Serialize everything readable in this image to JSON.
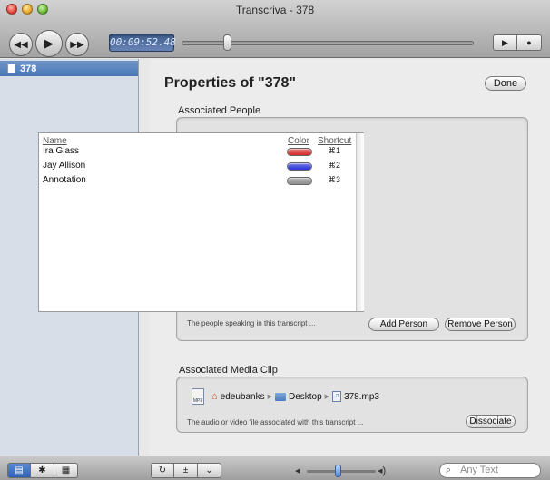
{
  "window": {
    "title": "Transcriva - 378"
  },
  "toolbar": {
    "timecode": "00:09:52.48",
    "rewind_icon": "rewind-icon",
    "play_icon": "play-icon",
    "forward_icon": "fast-forward-icon",
    "scrub_progress": 0.14
  },
  "sidebar": {
    "items": [
      {
        "label": "378",
        "selected": true
      }
    ]
  },
  "main": {
    "title": "Properties of \"378\"",
    "done_label": "Done",
    "people": {
      "section_label": "Associated People",
      "headers": {
        "name": "Name",
        "color": "Color",
        "shortcut": "Shortcut"
      },
      "rows": [
        {
          "name": "Ira Glass",
          "color": "#d62a2a",
          "shortcut": "⌘1"
        },
        {
          "name": "Jay Allison",
          "color": "#2a34d6",
          "shortcut": "⌘2"
        },
        {
          "name": "Annotation",
          "color": "#8f8f8f",
          "shortcut": "⌘3"
        }
      ],
      "caption": "The people speaking in this transcript ...",
      "add_label": "Add Person",
      "remove_label": "Remove Person"
    },
    "media": {
      "section_label": "Associated Media Clip",
      "file_icon_text": "MP3",
      "path": {
        "home": "edeubanks",
        "folder": "Desktop",
        "file": "378.mp3"
      },
      "caption": "The audio or video file associated with this transcript ...",
      "dissociate_label": "Dissociate"
    }
  },
  "bottombar": {
    "search_placeholder": "Any Text",
    "volume_level": 0.5
  }
}
